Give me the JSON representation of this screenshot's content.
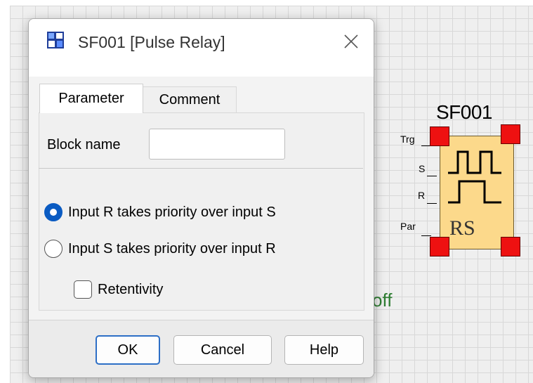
{
  "dialog": {
    "title": "SF001 [Pulse Relay]",
    "tabs": [
      {
        "label": "Parameter",
        "active": true
      },
      {
        "label": "Comment",
        "active": false
      }
    ],
    "block_name_label": "Block name",
    "block_name_value": "",
    "priority_options": [
      {
        "label": "Input R takes priority over input S",
        "selected": true
      },
      {
        "label": "Input S takes priority over input R",
        "selected": false
      }
    ],
    "retentivity_label": "Retentivity",
    "retentivity_checked": false,
    "buttons": {
      "ok": "OK",
      "cancel": "Cancel",
      "help": "Help"
    }
  },
  "block": {
    "name": "SF001",
    "pins": [
      "Trg",
      "S",
      "R",
      "Par"
    ],
    "symbol_text": "RS",
    "fill_color": "#fcd98b",
    "handle_color": "#ee1111"
  },
  "canvas": {
    "status_text": "off",
    "status_color": "#2e7d32"
  },
  "colors": {
    "accent": "#0a5bc2"
  }
}
